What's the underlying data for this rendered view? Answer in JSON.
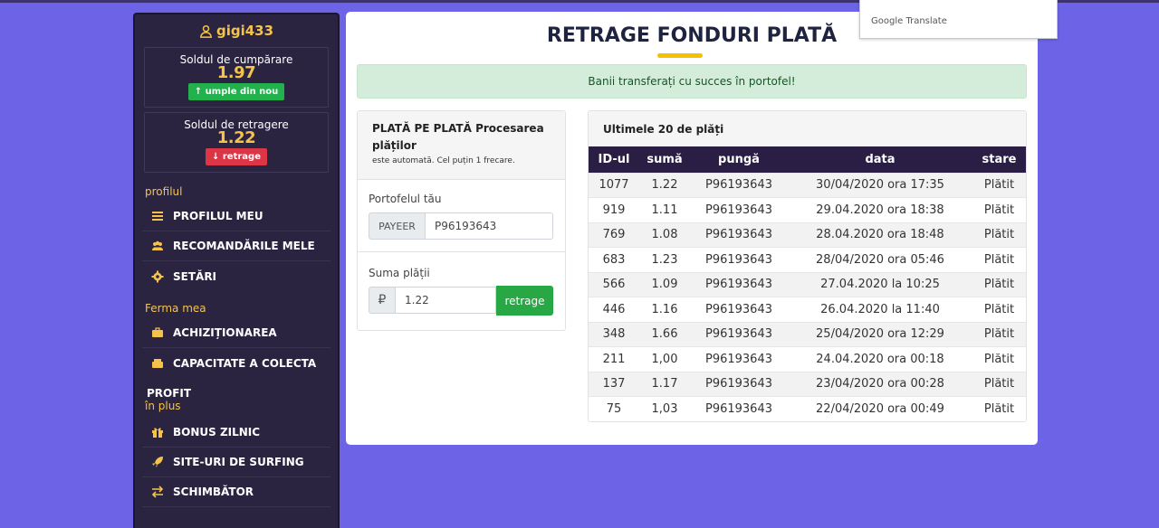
{
  "user": {
    "name": "gigi433"
  },
  "balances": {
    "purchase": {
      "title": "Soldul de cumpărare",
      "value": "1.97",
      "button": "umple din nou"
    },
    "withdraw": {
      "title": "Soldul de retragere",
      "value": "1.22",
      "button": "retrage"
    }
  },
  "sidebar": {
    "sections": [
      {
        "label": "profilul",
        "items": [
          "PROFILUL MEU",
          "RECOMANDĂRILE MELE",
          "SETĂRI"
        ]
      },
      {
        "label": "Ferma mea",
        "items": [
          "ACHIZIȚIONAREA",
          "CAPACITATE A COLECTA"
        ]
      },
      {
        "label_top": "PROFIT",
        "label": "în plus",
        "items": [
          "BONUS ZILNIC",
          "SITE-URI DE SURFING",
          "SCHIMBĂTOR"
        ]
      }
    ]
  },
  "main": {
    "title_part1": "RETRAGE ",
    "title_part2": "FONDURI PLATĂ",
    "alert": "Banii transferați cu succes în portofel!",
    "payment_card": {
      "title": "PLATĂ PE PLATĂ Procesarea plăților",
      "subtitle": "este automată. Cel puțin 1 frecare.",
      "wallet_label": "Portofelul tău",
      "wallet_addon": "PAYEER",
      "wallet_value": "P96193643",
      "amount_label": "Suma plății",
      "currency_symbol": "₽",
      "amount_value": "1.22",
      "submit_label": "retrage"
    },
    "payments_card": {
      "title": "Ultimele 20 de plăți",
      "columns": [
        "ID-ul",
        "sumă",
        "pungă",
        "data",
        "stare"
      ],
      "rows": [
        [
          "1077",
          "1.22",
          "P96193643",
          "30/04/2020 ora 17:35",
          "Plătit"
        ],
        [
          "919",
          "1.11",
          "P96193643",
          "29.04.2020 ora 18:38",
          "Plătit"
        ],
        [
          "769",
          "1.08",
          "P96193643",
          "28.04.2020 ora 18:48",
          "Plătit"
        ],
        [
          "683",
          "1.23",
          "P96193643",
          "28/04/2020 ora 05:46",
          "Plătit"
        ],
        [
          "566",
          "1.09",
          "P96193643",
          "27.04.2020 la 10:25",
          "Plătit"
        ],
        [
          "446",
          "1.16",
          "P96193643",
          "26.04.2020 la 11:40",
          "Plătit"
        ],
        [
          "348",
          "1.66",
          "P96193643",
          "25/04/2020 ora 12:29",
          "Plătit"
        ],
        [
          "211",
          "1,00",
          "P96193643",
          "24.04.2020 ora 00:18",
          "Plătit"
        ],
        [
          "137",
          "1.17",
          "P96193643",
          "23/04/2020 ora 00:28",
          "Plătit"
        ],
        [
          "75",
          "1,03",
          "P96193643",
          "22/04/2020 ora 00:49",
          "Plătit"
        ]
      ]
    }
  },
  "google_translate": {
    "label_google": "Google",
    "label_translate": "Translate"
  },
  "colors": {
    "background": "#6c63e6",
    "accent_yellow": "#f5c34a",
    "sidebar": "#2a2440",
    "success": "#28a745",
    "danger": "#dc3545"
  }
}
